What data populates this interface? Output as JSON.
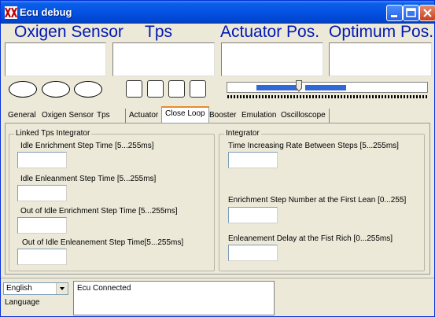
{
  "window": {
    "title": "Ecu debug"
  },
  "headers": [
    "Oxigen Sensor",
    "Tps",
    "Actuator Pos.",
    "Optimum Pos."
  ],
  "tabs": [
    "General",
    "Oxigen Sensor",
    "Tps",
    "Actuator",
    "Close Loop",
    "Booster",
    "Emulation",
    "Oscilloscope"
  ],
  "active_tab": "Close Loop",
  "slider": {
    "position": 0.37
  },
  "left_group": {
    "title": "Linked Tps Integrator",
    "fields": [
      {
        "label": "Idle Enrichment Step Time [5...255ms]",
        "value": ""
      },
      {
        "label": "Idle Enleanment Step Time [5...255ms]",
        "value": ""
      },
      {
        "label": "Out of Idle Enrichment Step Time [5...255ms]",
        "value": ""
      },
      {
        "label": "Out of Idle Enleanement Step Time[5...255ms]",
        "value": ""
      }
    ]
  },
  "right_group": {
    "title": "Integrator",
    "fields": [
      {
        "label": "Time Increasing Rate Between Steps [5...255ms]",
        "value": ""
      },
      {
        "label": "Enrichment Step Number at the First Lean [0...255]",
        "value": ""
      },
      {
        "label": "Enleanement Delay at the Fist Rich [0...255ms]",
        "value": ""
      }
    ]
  },
  "language": {
    "selected": "English",
    "label": "Language"
  },
  "status": {
    "text": "Ecu Connected"
  },
  "colors": {
    "header_text": "#0018b4",
    "title_bar": "#0552e3",
    "slider_bar": "#3168d8",
    "active_tab_accent": "#e68b2c"
  }
}
